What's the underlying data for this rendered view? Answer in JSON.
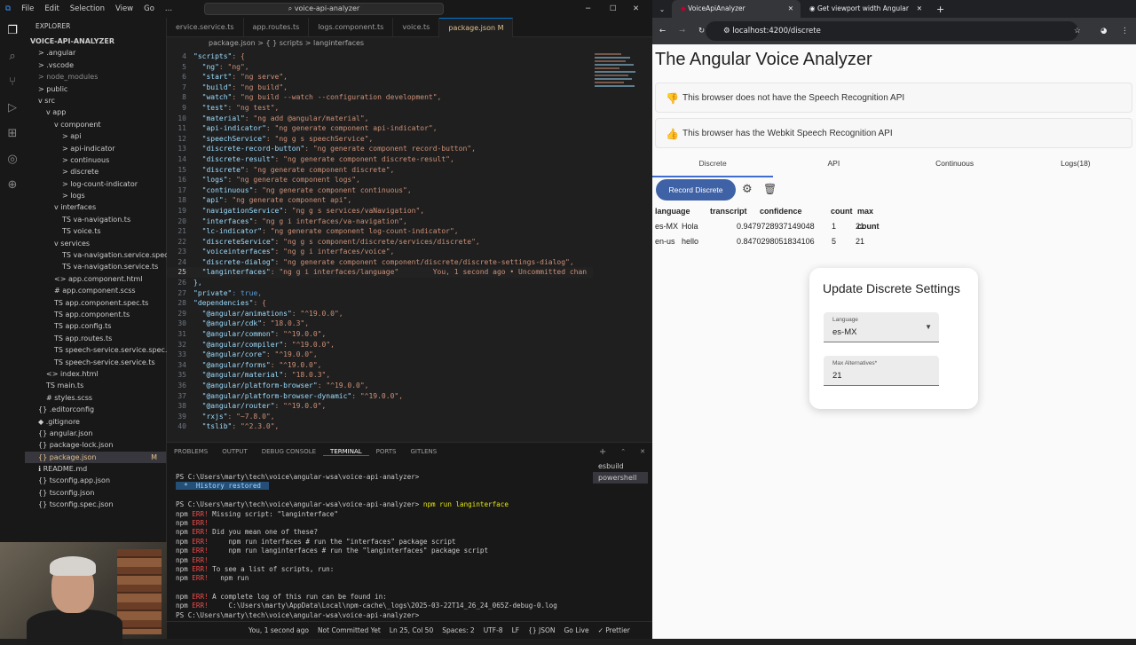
{
  "vscode": {
    "menu": [
      "File",
      "Edit",
      "Selection",
      "View",
      "Go",
      "..."
    ],
    "command_center": "voice-api-analyzer",
    "tabs": [
      "ervice.service.ts",
      "app.routes.ts",
      "logs.component.ts",
      "voice.ts",
      "package.json"
    ],
    "tab_modified": "M",
    "breadcrumb": "package.json  >  { } scripts  >  langinterfaces",
    "explorer_title": "EXPLORER",
    "tree": [
      {
        "label": "VOICE-API-ANALYZER",
        "indent": 0,
        "bold": true
      },
      {
        "label": "> .angular",
        "indent": 1
      },
      {
        "label": "> .vscode",
        "indent": 1
      },
      {
        "label": "> node_modules",
        "indent": 1,
        "dim": true
      },
      {
        "label": "> public",
        "indent": 1
      },
      {
        "label": "v src",
        "indent": 1
      },
      {
        "label": "v app",
        "indent": 2
      },
      {
        "label": "v component",
        "indent": 3
      },
      {
        "label": "> api",
        "indent": 4
      },
      {
        "label": "> api-indicator",
        "indent": 4
      },
      {
        "label": "> continuous",
        "indent": 4
      },
      {
        "label": "> discrete",
        "indent": 4
      },
      {
        "label": "> log-count-indicator",
        "indent": 4
      },
      {
        "label": "> logs",
        "indent": 4
      },
      {
        "label": "v interfaces",
        "indent": 3
      },
      {
        "label": "TS va-navigation.ts",
        "indent": 4
      },
      {
        "label": "TS voice.ts",
        "indent": 4
      },
      {
        "label": "v services",
        "indent": 3
      },
      {
        "label": "TS va-navigation.service.spec.ts",
        "indent": 4
      },
      {
        "label": "TS va-navigation.service.ts",
        "indent": 4
      },
      {
        "label": "<> app.component.html",
        "indent": 3
      },
      {
        "label": "# app.component.scss",
        "indent": 3
      },
      {
        "label": "TS app.component.spec.ts",
        "indent": 3
      },
      {
        "label": "TS app.component.ts",
        "indent": 3
      },
      {
        "label": "TS app.config.ts",
        "indent": 3
      },
      {
        "label": "TS app.routes.ts",
        "indent": 3
      },
      {
        "label": "TS speech-service.service.spec.ts",
        "indent": 3
      },
      {
        "label": "TS speech-service.service.ts",
        "indent": 3
      },
      {
        "label": "<> index.html",
        "indent": 2
      },
      {
        "label": "TS main.ts",
        "indent": 2
      },
      {
        "label": "# styles.scss",
        "indent": 2
      },
      {
        "label": "{} .editorconfig",
        "indent": 1
      },
      {
        "label": "◆ .gitignore",
        "indent": 1
      },
      {
        "label": "{} angular.json",
        "indent": 1
      },
      {
        "label": "{} package-lock.json",
        "indent": 1
      },
      {
        "label": "{} package.json",
        "indent": 1,
        "selected": true,
        "mark": "M"
      },
      {
        "label": "ℹ README.md",
        "indent": 1
      },
      {
        "label": "{} tsconfig.app.json",
        "indent": 1
      },
      {
        "label": "{} tsconfig.json",
        "indent": 1
      },
      {
        "label": "{} tsconfig.spec.json",
        "indent": 1
      }
    ],
    "code": [
      {
        "n": "4",
        "k": "\"scripts\"",
        "v": ": {"
      },
      {
        "n": "5",
        "k": "  \"ng\"",
        "v": ": \"ng\","
      },
      {
        "n": "6",
        "k": "  \"start\"",
        "v": ": \"ng serve\","
      },
      {
        "n": "7",
        "k": "  \"build\"",
        "v": ": \"ng build\","
      },
      {
        "n": "8",
        "k": "  \"watch\"",
        "v": ": \"ng build --watch --configuration development\","
      },
      {
        "n": "9",
        "k": "  \"test\"",
        "v": ": \"ng test\","
      },
      {
        "n": "10",
        "k": "  \"material\"",
        "v": ": \"ng add @angular/material\","
      },
      {
        "n": "11",
        "k": "  \"api-indicator\"",
        "v": ": \"ng generate component api-indicator\","
      },
      {
        "n": "12",
        "k": "  \"speechService\"",
        "v": ": \"ng g s speechService\","
      },
      {
        "n": "13",
        "k": "  \"discrete-record-button\"",
        "v": ": \"ng generate component record-button\","
      },
      {
        "n": "14",
        "k": "  \"discrete-result\"",
        "v": ": \"ng generate component discrete-result\","
      },
      {
        "n": "15",
        "k": "  \"discrete\"",
        "v": ": \"ng generate component discrete\","
      },
      {
        "n": "16",
        "k": "  \"logs\"",
        "v": ": \"ng generate component logs\","
      },
      {
        "n": "17",
        "k": "  \"continuous\"",
        "v": ": \"ng generate component continuous\","
      },
      {
        "n": "18",
        "k": "  \"api\"",
        "v": ": \"ng generate component api\","
      },
      {
        "n": "19",
        "k": "  \"navigationService\"",
        "v": ": \"ng g s services/vaNavigation\","
      },
      {
        "n": "20",
        "k": "  \"interfaces\"",
        "v": ": \"ng g i interfaces/va-navigation\","
      },
      {
        "n": "21",
        "k": "  \"lc-indicator\"",
        "v": ": \"ng generate component log-count-indicator\","
      },
      {
        "n": "22",
        "k": "  \"discreteService\"",
        "v": ": \"ng g s component/discrete/services/discrete\","
      },
      {
        "n": "23",
        "k": "  \"voiceinterfaces\"",
        "v": ": \"ng g i interfaces/voice\","
      },
      {
        "n": "24",
        "k": "  \"discrete-dialog\"",
        "v": ": \"ng generate component component/discrete/discrete-settings-dialog\","
      },
      {
        "n": "25",
        "k": "  \"langinterfaces\"",
        "v": ": \"ng g i interfaces/language\"        You, 1 second ago • Uncommitted chan",
        "cur": true
      },
      {
        "n": "26",
        "k": "},",
        "v": ""
      },
      {
        "n": "27",
        "k": "\"private\"",
        "v": ": true,"
      },
      {
        "n": "28",
        "k": "\"dependencies\"",
        "v": ": {"
      },
      {
        "n": "29",
        "k": "  \"@angular/animations\"",
        "v": ": \"^19.0.0\","
      },
      {
        "n": "30",
        "k": "  \"@angular/cdk\"",
        "v": ": \"18.0.3\","
      },
      {
        "n": "31",
        "k": "  \"@angular/common\"",
        "v": ": \"^19.0.0\","
      },
      {
        "n": "32",
        "k": "  \"@angular/compiler\"",
        "v": ": \"^19.0.0\","
      },
      {
        "n": "33",
        "k": "  \"@angular/core\"",
        "v": ": \"^19.0.0\","
      },
      {
        "n": "34",
        "k": "  \"@angular/forms\"",
        "v": ": \"^19.0.0\","
      },
      {
        "n": "35",
        "k": "  \"@angular/material\"",
        "v": ": \"18.0.3\","
      },
      {
        "n": "36",
        "k": "  \"@angular/platform-browser\"",
        "v": ": \"^19.0.0\","
      },
      {
        "n": "37",
        "k": "  \"@angular/platform-browser-dynamic\"",
        "v": ": \"^19.0.0\","
      },
      {
        "n": "38",
        "k": "  \"@angular/router\"",
        "v": ": \"^19.0.0\","
      },
      {
        "n": "39",
        "k": "  \"rxjs\"",
        "v": ": \"~7.8.0\","
      },
      {
        "n": "40",
        "k": "  \"tslib\"",
        "v": ": \"^2.3.0\","
      }
    ],
    "panel_tabs": [
      "PROBLEMS",
      "OUTPUT",
      "DEBUG CONSOLE",
      "TERMINAL",
      "PORTS",
      "GITLENS"
    ],
    "terminal_list": [
      "esbuild",
      "powershell"
    ],
    "terminal": [
      {
        "t": "PS C:\\Users\\marty\\tech\\voice\\angular-wsa\\voice-api-analyzer>"
      },
      {
        "t": "  *  History restored  ",
        "hl": true
      },
      {
        "t": ""
      },
      {
        "t": "PS C:\\Users\\marty\\tech\\voice\\angular-wsa\\voice-api-analyzer> npm run langinterface"
      },
      {
        "t": "npm ERR! Missing script: \"langinterface\""
      },
      {
        "t": "npm ERR!"
      },
      {
        "t": "npm ERR! Did you mean one of these?"
      },
      {
        "t": "npm ERR!     npm run interfaces # run the \"interfaces\" package script"
      },
      {
        "t": "npm ERR!     npm run langinterfaces # run the \"langinterfaces\" package script"
      },
      {
        "t": "npm ERR!"
      },
      {
        "t": "npm ERR! To see a list of scripts, run:"
      },
      {
        "t": "npm ERR!   npm run"
      },
      {
        "t": ""
      },
      {
        "t": "npm ERR! A complete log of this run can be found in:"
      },
      {
        "t": "npm ERR!     C:\\Users\\marty\\AppData\\Local\\npm-cache\\_logs\\2025-03-22T14_26_24_065Z-debug-0.log"
      },
      {
        "t": "PS C:\\Users\\marty\\tech\\voice\\angular-wsa\\voice-api-analyzer> "
      }
    ],
    "status": [
      "You, 1 second ago",
      "Not Committed Yet",
      "Ln 25, Col 50",
      "Spaces: 2",
      "UTF-8",
      "LF",
      "{} JSON",
      "Go Live",
      "✓ Prettier"
    ]
  },
  "browser": {
    "tabs": [
      "VoiceApiAnalyzer",
      "Get viewport width Angular"
    ],
    "url": "localhost:4200/discrete",
    "title": "The Angular Voice Analyzer",
    "msg_no_api": "This browser does not have the Speech Recognition API",
    "msg_webkit": "This browser has the Webkit Speech Recognition API",
    "nav_tabs": [
      "Discrete",
      "API",
      "Continuous",
      "Logs(18)"
    ],
    "record_button": "Record Discrete",
    "table": {
      "headers": [
        "language",
        "transcript",
        "confidence",
        "count",
        "max count"
      ],
      "rows": [
        [
          "es-MX",
          "Hola",
          "0.9479728937149048",
          "1",
          "21"
        ],
        [
          "en-us",
          "hello",
          "0.8470298051834106",
          "5",
          "21"
        ]
      ]
    },
    "dialog": {
      "title": "Update Discrete Settings",
      "language_label": "Language",
      "language_value": "es-MX",
      "max_label": "Max Alternatives*",
      "max_value": "21"
    },
    "colors": {
      "primary": "#3f62a6",
      "thumbs_down": "#c62828",
      "thumbs_up": "#2e7d32"
    }
  }
}
